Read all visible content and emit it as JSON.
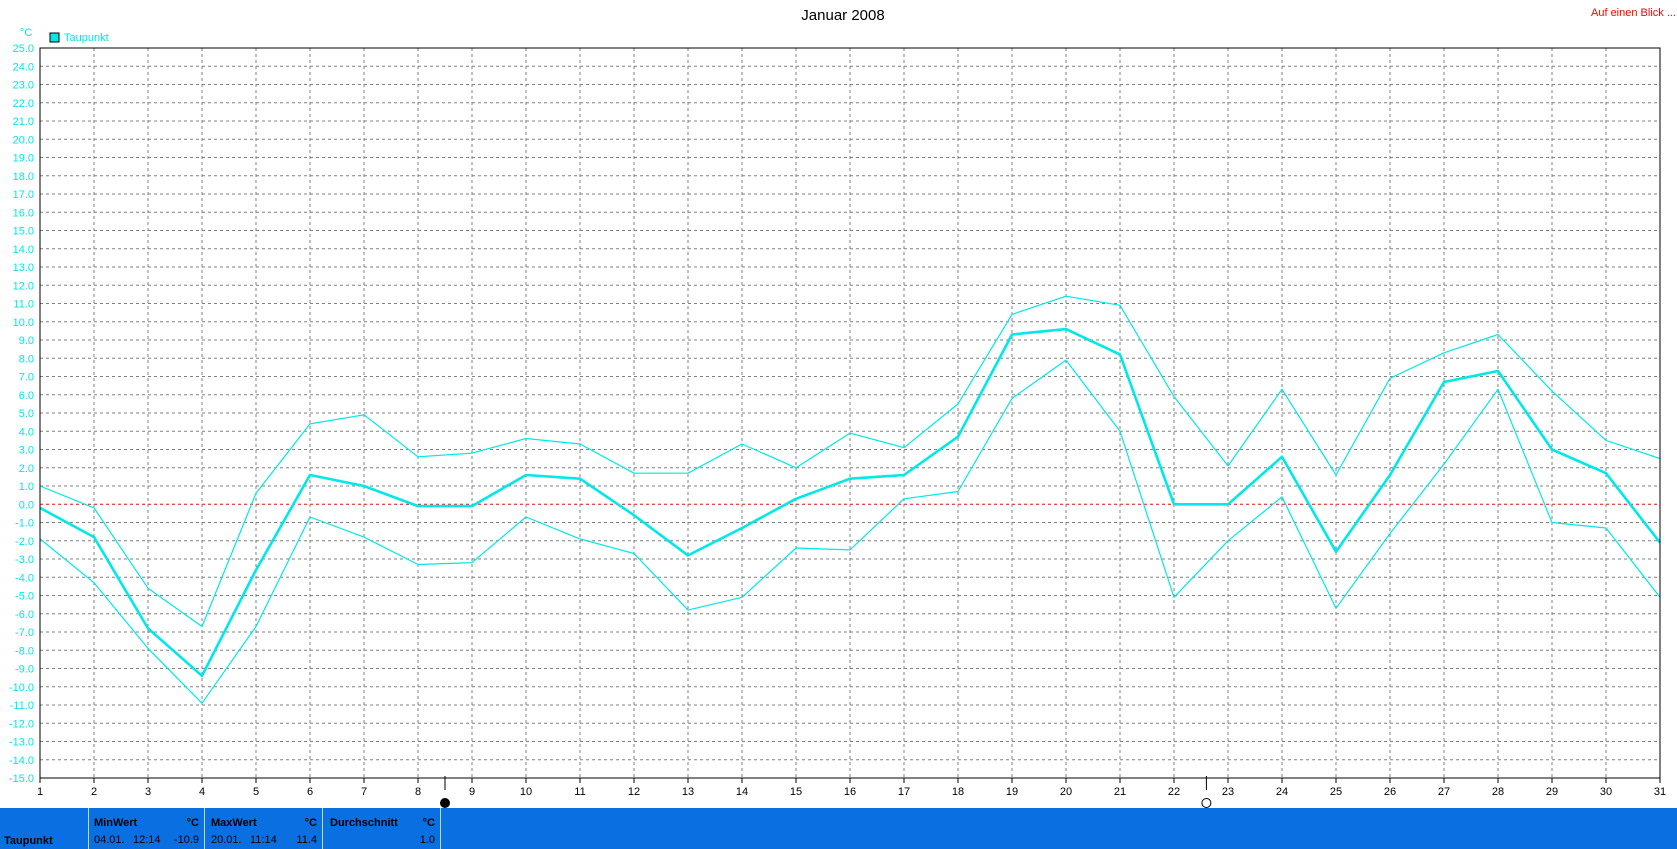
{
  "chart_data": {
    "type": "line",
    "title": "Januar 2008",
    "ylabel": "°C",
    "ylim": [
      -15,
      25
    ],
    "ystep": 1,
    "x": [
      1,
      2,
      3,
      4,
      5,
      6,
      7,
      8,
      9,
      10,
      11,
      12,
      13,
      14,
      15,
      16,
      17,
      18,
      19,
      20,
      21,
      22,
      23,
      24,
      25,
      26,
      27,
      28,
      29,
      30,
      31
    ],
    "legend": "top-left",
    "grid": true,
    "zero_line": true,
    "series": [
      {
        "name": "Taupunkt",
        "role": "avg",
        "values": [
          -0.2,
          -1.8,
          -6.8,
          -9.4,
          -3.6,
          1.6,
          1.0,
          -0.1,
          -0.1,
          1.6,
          1.4,
          -0.6,
          -2.8,
          -1.3,
          0.3,
          1.4,
          1.6,
          3.7,
          9.3,
          9.6,
          8.2,
          0.0,
          0.0,
          2.6,
          -2.6,
          1.6,
          6.7,
          7.3,
          3.0,
          1.7,
          -2.1
        ]
      },
      {
        "role": "max",
        "values": [
          1.0,
          -0.2,
          -4.6,
          -6.7,
          0.6,
          4.4,
          4.9,
          2.6,
          2.8,
          3.6,
          3.3,
          1.7,
          1.7,
          3.3,
          2.0,
          3.9,
          3.1,
          5.5,
          10.4,
          11.4,
          10.9,
          5.9,
          2.1,
          6.3,
          1.6,
          6.9,
          8.3,
          9.3,
          6.2,
          3.5,
          2.5
        ]
      },
      {
        "role": "min",
        "values": [
          -1.9,
          -4.3,
          -7.9,
          -10.9,
          -6.7,
          -0.7,
          -1.8,
          -3.3,
          -3.2,
          -0.7,
          -1.9,
          -2.7,
          -5.8,
          -5.1,
          -2.4,
          -2.5,
          0.3,
          0.7,
          5.8,
          7.9,
          4.0,
          -5.1,
          -2.0,
          0.4,
          -5.7,
          -1.6,
          2.2,
          6.3,
          -1.0,
          -1.3,
          -5.1
        ]
      }
    ],
    "colors": {
      "series": "#00e8e8",
      "axis_text": "#00e8e8",
      "zero": "#ff0000",
      "grid": "#808080"
    }
  },
  "header": {
    "link": "Auf einen Blick ..."
  },
  "footer": {
    "row_label": "Taupunkt",
    "min": {
      "label": "MinWert",
      "unit": "°C",
      "date": "04.01.",
      "time": "12:14",
      "value": "-10.9"
    },
    "max": {
      "label": "MaxWert",
      "unit": "°C",
      "date": "20.01.",
      "time": "11:14",
      "value": "11.4"
    },
    "avg": {
      "label": "Durchschnitt",
      "unit": "°C",
      "value": "1.0"
    },
    "color": "#0a6fe0"
  }
}
